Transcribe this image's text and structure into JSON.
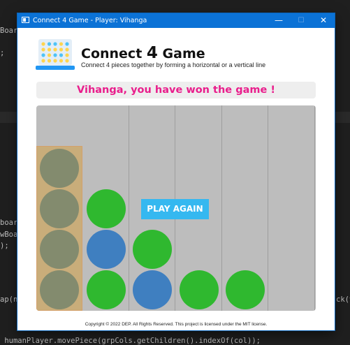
{
  "editor": {
    "lines": [
      "Boar",
      ";",
      "board",
      "wBoa",
      ");",
      "ap(n",
      "ck(v",
      " humanPlayer.movePiece(grpCols.getChildren().indexOf(col));"
    ]
  },
  "window": {
    "title": "Connect 4 Game - Player: Vihanga",
    "controls": {
      "minimize": "—",
      "maximize": "☐",
      "close": "✕"
    }
  },
  "header": {
    "title_prefix": "Connect ",
    "title_number": "4",
    "title_suffix": " Game",
    "subtitle": "Connect 4 pieces together by forming a horizontal or a vertical line"
  },
  "status": {
    "message": "Vihanga, you have won the game !"
  },
  "board": {
    "columns": 6,
    "rows": 5,
    "winning_column": 0,
    "colors": {
      "green": "#2fb82f",
      "blue": "#3f7fc0",
      "faded": "#838b6e",
      "board": "#bdbdbd",
      "highlight": "#c9ad7a"
    },
    "discs": [
      {
        "col": 0,
        "row": 1,
        "color": "faded"
      },
      {
        "col": 0,
        "row": 2,
        "color": "faded"
      },
      {
        "col": 0,
        "row": 3,
        "color": "faded"
      },
      {
        "col": 0,
        "row": 4,
        "color": "faded"
      },
      {
        "col": 1,
        "row": 2,
        "color": "green"
      },
      {
        "col": 1,
        "row": 3,
        "color": "blue"
      },
      {
        "col": 1,
        "row": 4,
        "color": "green"
      },
      {
        "col": 2,
        "row": 3,
        "color": "green"
      },
      {
        "col": 2,
        "row": 4,
        "color": "blue"
      },
      {
        "col": 3,
        "row": 4,
        "color": "green"
      },
      {
        "col": 4,
        "row": 4,
        "color": "green"
      }
    ]
  },
  "actions": {
    "play_again_label": "PLAY AGAIN"
  },
  "footer": {
    "text": "Copyright © 2022 DEP. All Rights Reserved. This project is licensed under the MIT license."
  }
}
